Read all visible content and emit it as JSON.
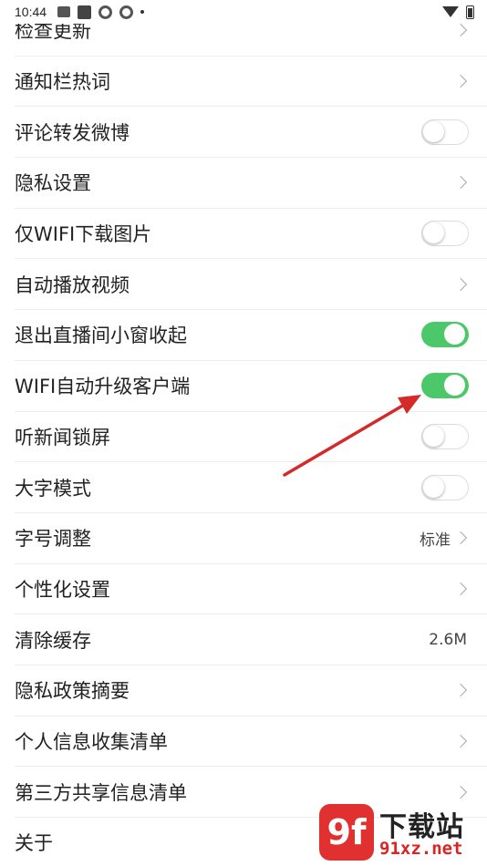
{
  "status_bar": {
    "time": "10:44",
    "icons": [
      "notification-app-icon",
      "square-app-icon",
      "aperture-icon",
      "aperture-icon",
      "dot-icon",
      "wifi-icon",
      "battery-icon"
    ]
  },
  "settings": [
    {
      "label": "检查更新",
      "control": "chevron"
    },
    {
      "label": "通知栏热词",
      "control": "chevron"
    },
    {
      "label": "评论转发微博",
      "control": "toggle",
      "on": false
    },
    {
      "label": "隐私设置",
      "control": "chevron"
    },
    {
      "label": "仅WIFI下载图片",
      "control": "toggle",
      "on": false
    },
    {
      "label": "自动播放视频",
      "control": "chevron"
    },
    {
      "label": "退出直播间小窗收起",
      "control": "toggle",
      "on": true
    },
    {
      "label": "WIFI自动升级客户端",
      "control": "toggle",
      "on": true
    },
    {
      "label": "听新闻锁屏",
      "control": "toggle",
      "on": false
    },
    {
      "label": "大字模式",
      "control": "toggle",
      "on": false
    },
    {
      "label": "字号调整",
      "control": "value-chevron",
      "value": "标准"
    },
    {
      "label": "个性化设置",
      "control": "chevron"
    },
    {
      "label": "清除缓存",
      "control": "value",
      "value": "2.6M"
    },
    {
      "label": "隐私政策摘要",
      "control": "chevron"
    },
    {
      "label": "个人信息收集清单",
      "control": "chevron"
    },
    {
      "label": "第三方共享信息清单",
      "control": "chevron"
    },
    {
      "label": "关于",
      "control": "none"
    }
  ],
  "colors": {
    "toggle_on": "#4cc76a",
    "annotation_arrow": "#d42a2a",
    "watermark_red": "#e03030"
  },
  "watermark": {
    "logo_text": "9f",
    "site_name": "下载站",
    "url": "91xz.net"
  }
}
